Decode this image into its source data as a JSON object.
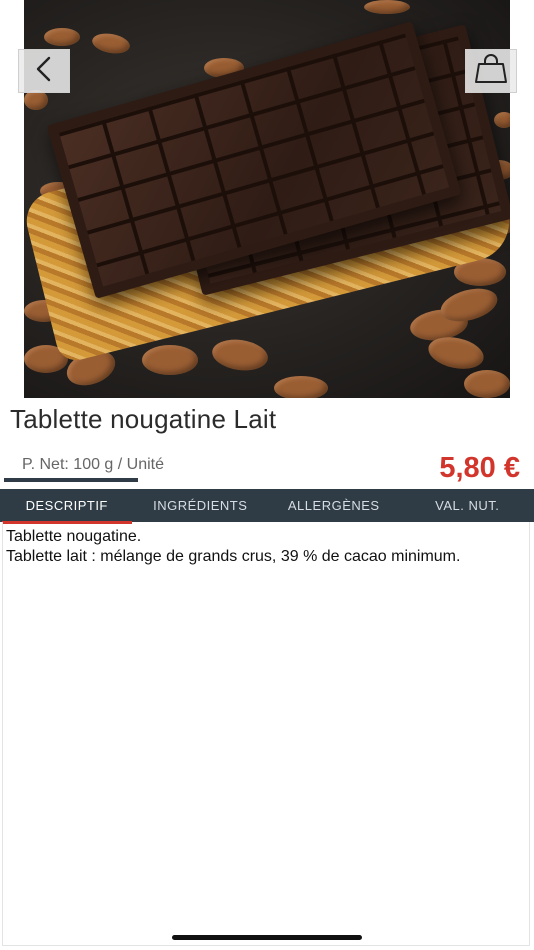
{
  "product": {
    "title": "Tablette nougatine Lait",
    "net_weight": "P. Net: 100 g / Unité",
    "price": "5,80 €"
  },
  "hero": {
    "image_alt": "Tablette de chocolat sur nougatine et amandes",
    "back_icon": "chevron-left-icon",
    "cart_icon": "shopping-bag-icon"
  },
  "tabs": [
    {
      "label": "DESCRIPTIF",
      "active": true
    },
    {
      "label": "INGRÉDIENTS",
      "active": false
    },
    {
      "label": "ALLERGÈNES",
      "active": false
    },
    {
      "label": "VAL. NUT.",
      "active": false
    }
  ],
  "description": {
    "line1": "Tablette nougatine.",
    "line2": "Tablette lait : mélange de grands crus, 39 % de cacao minimum."
  },
  "colors": {
    "accent_red": "#d2352b",
    "tab_bar": "#2f3c46"
  }
}
